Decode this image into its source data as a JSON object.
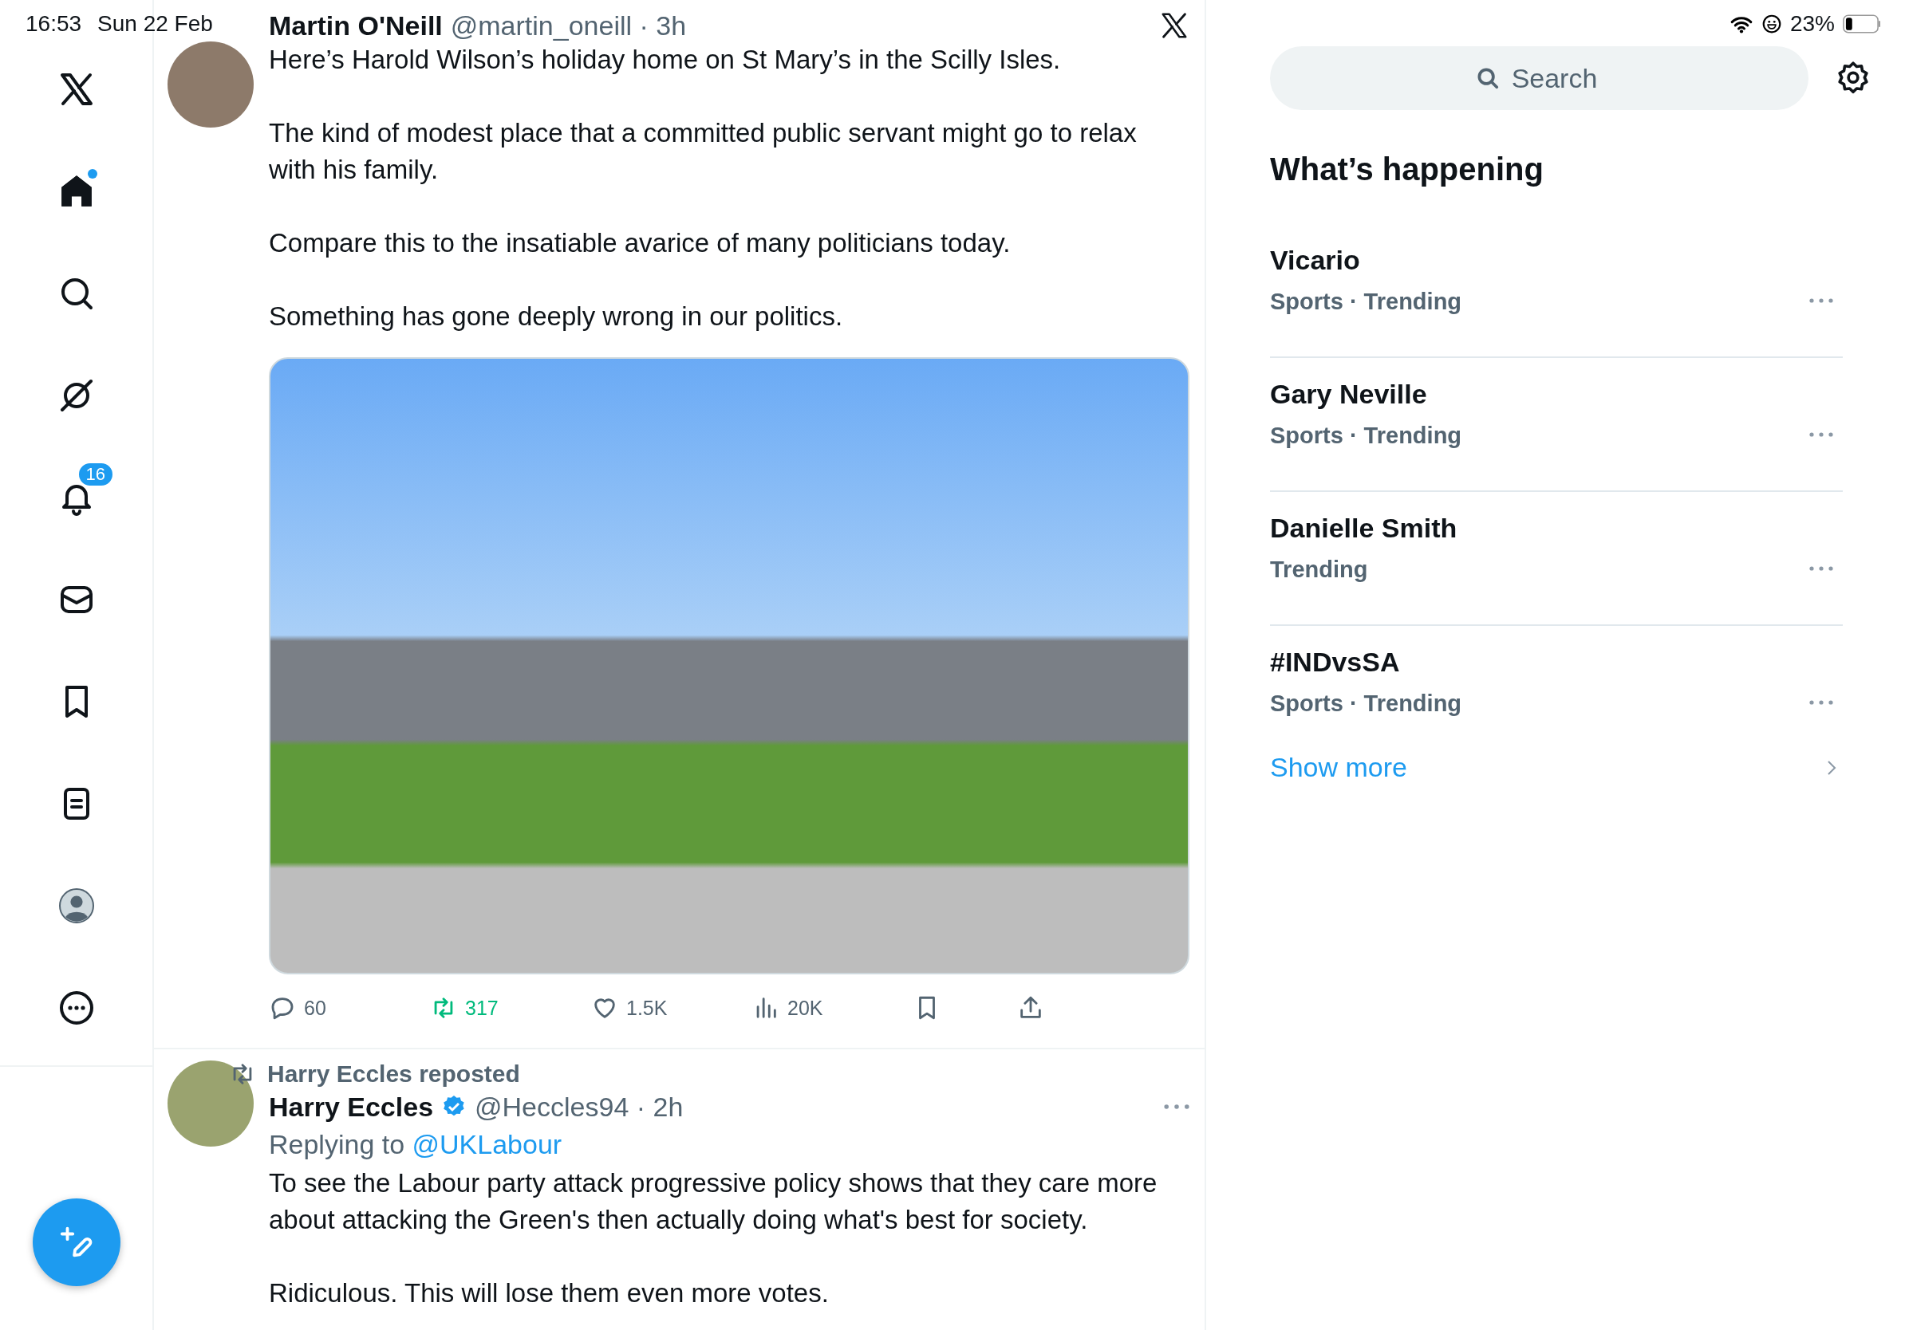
{
  "status_bar": {
    "time": "16:53",
    "date": "Sun 22 Feb",
    "battery": "23%"
  },
  "sidebar": {
    "items": [
      {
        "kind": "logo",
        "selected": false,
        "dot": false
      },
      {
        "kind": "home",
        "selected": true,
        "dot": true
      },
      {
        "kind": "search",
        "selected": false,
        "dot": false
      },
      {
        "kind": "grok",
        "selected": false,
        "dot": false
      },
      {
        "kind": "notifications",
        "selected": false,
        "dot": false,
        "badge": "16"
      },
      {
        "kind": "messages",
        "selected": false,
        "dot": false
      },
      {
        "kind": "bookmarks",
        "selected": false,
        "dot": false
      },
      {
        "kind": "lists",
        "selected": false,
        "dot": false
      },
      {
        "kind": "profile",
        "selected": false,
        "dot": false
      },
      {
        "kind": "more",
        "selected": false,
        "dot": false
      }
    ]
  },
  "timeline": {
    "posts": [
      {
        "author": "Martin O'Neill",
        "verified": false,
        "meta": "@martin_oneill · 3h",
        "corner": {
          "kind": "close"
        },
        "paragraphs": [
          "Here’s Harold Wilson’s holiday home on St Mary’s in the Scilly Isles.",
          "The kind of modest place that a committed public servant might go to relax with his family.",
          "Compare this to the insatiable avarice of many politicians today.",
          "Something has gone deeply wrong in our politics."
        ],
        "media": {
          "kind": "photo"
        },
        "actions": [
          {
            "kind": "reply",
            "count": "60",
            "active": false
          },
          {
            "kind": "repost",
            "count": "317",
            "active": true
          },
          {
            "kind": "like",
            "count": "1.5K",
            "active": false
          },
          {
            "kind": "views",
            "count": "20K",
            "active": false
          },
          {
            "kind": "bookmark",
            "active": false
          },
          {
            "kind": "share",
            "active": false
          }
        ]
      },
      {
        "reposted_by": "Harry Eccles reposted",
        "author": "Harry Eccles",
        "verified": true,
        "meta": "@Heccles94 · 2h",
        "corner": {
          "kind": "more"
        },
        "replying_to": {
          "prefix": "Replying to",
          "handle": "@UKLabour"
        },
        "paragraphs": [
          "To see the Labour party attack progressive policy shows that they care more about attacking the Green's then actually doing what's best for society.",
          "Ridiculous. This will lose them even more votes."
        ]
      }
    ]
  },
  "sidebar_right": {
    "search": {
      "placeholder": "Search"
    },
    "section_title": "What’s happening",
    "trends": [
      {
        "title": "Vicario",
        "meta": "Sports · Trending"
      },
      {
        "title": "Gary Neville",
        "meta": "Sports · Trending"
      },
      {
        "title": "Danielle Smith",
        "meta": "Trending"
      },
      {
        "title": "#INDvsSA",
        "meta": "Sports · Trending"
      }
    ],
    "show_more": "Show more"
  }
}
